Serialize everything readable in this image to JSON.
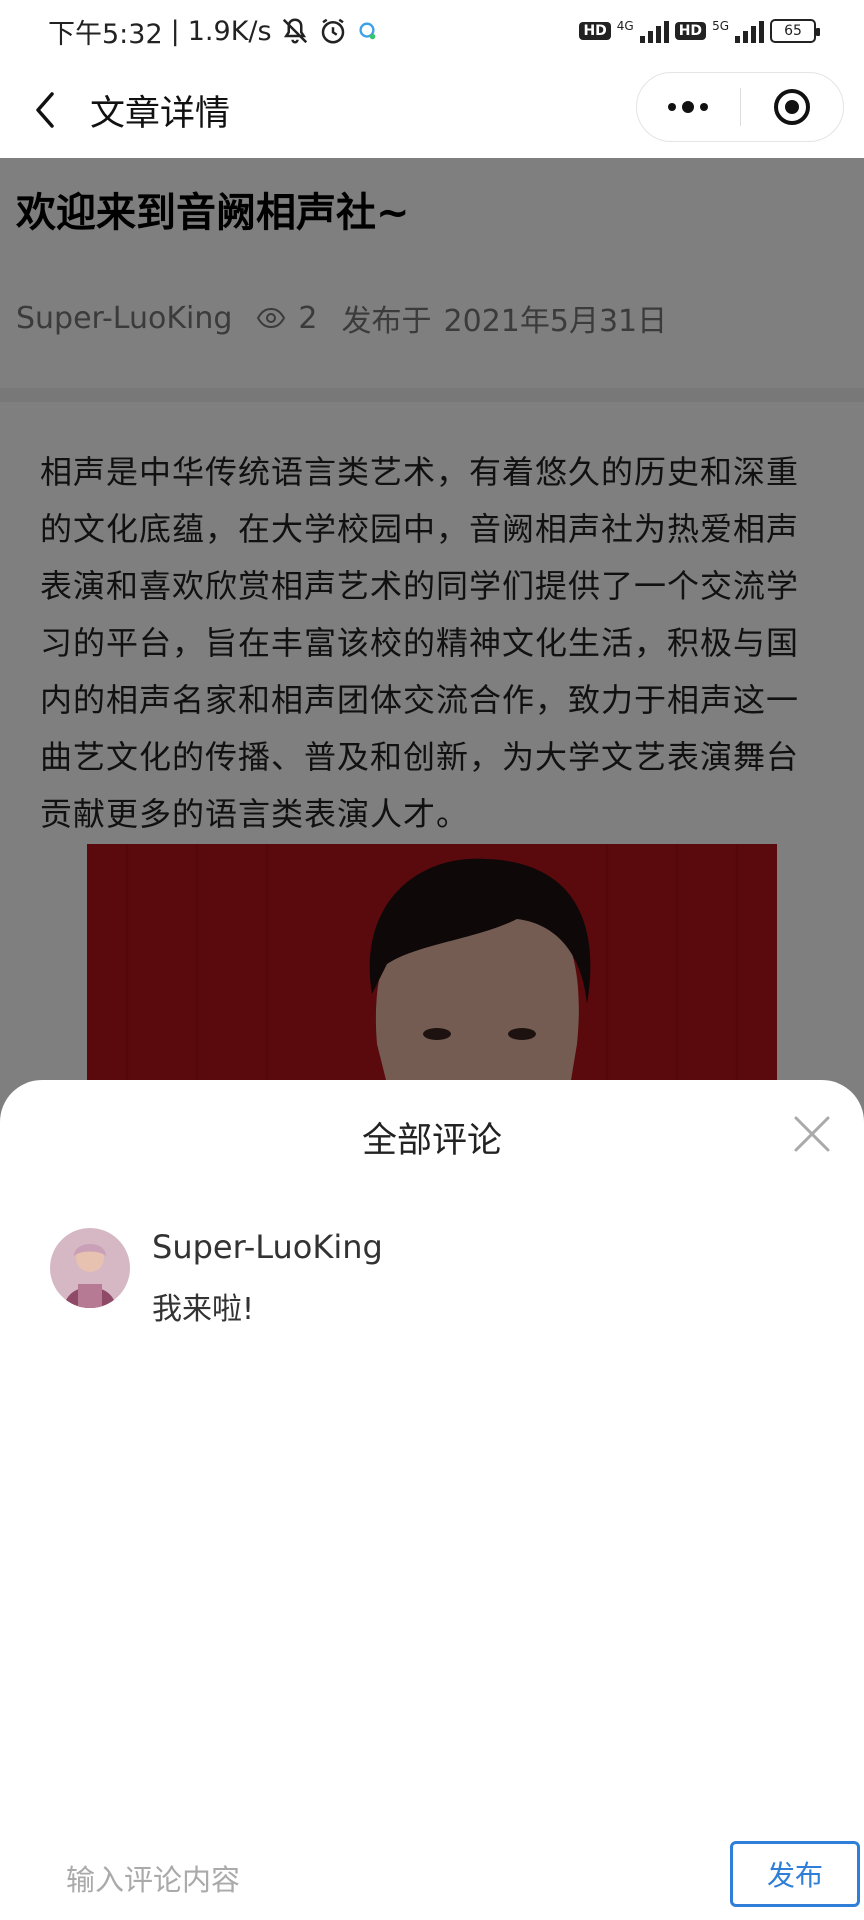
{
  "status_bar": {
    "time": "下午5:32",
    "speed": "1.9K/s",
    "hd1": "HD",
    "net1": "4G",
    "hd2": "HD",
    "net2": "5G",
    "battery": "65"
  },
  "nav": {
    "title": "文章详情",
    "back_icon": "chevron-left-icon",
    "more_icon": "more-dots-icon",
    "close_icon": "target-close-icon"
  },
  "article": {
    "title": "欢迎来到音阙相声社~",
    "author": "Super-LuoKing",
    "views": "2",
    "published_prefix": "发布于",
    "published_date": "2021年5月31日",
    "body": "相声是中华传统语言类艺术，有着悠久的历史和深重的文化底蕴，在大学校园中，音阙相声社为热爱相声表演和喜欢欣赏相声艺术的同学们提供了一个交流学习的平台，旨在丰富该校的精神文化生活，积极与国内的相声名家和相声团体交流合作，致力于相声这一曲艺文化的传播、普及和创新，为大学文艺表演舞台贡献更多的语言类表演人才。"
  },
  "comments_panel": {
    "title": "全部评论",
    "comments": [
      {
        "user": "Super-LuoKing",
        "text": "我来啦!"
      }
    ],
    "input_placeholder": "输入评论内容",
    "publish_label": "发布"
  },
  "colors": {
    "accent": "#2f7ed8",
    "overlay": "rgba(0,0,0,0.5)",
    "image_bg": "#b5141a"
  }
}
